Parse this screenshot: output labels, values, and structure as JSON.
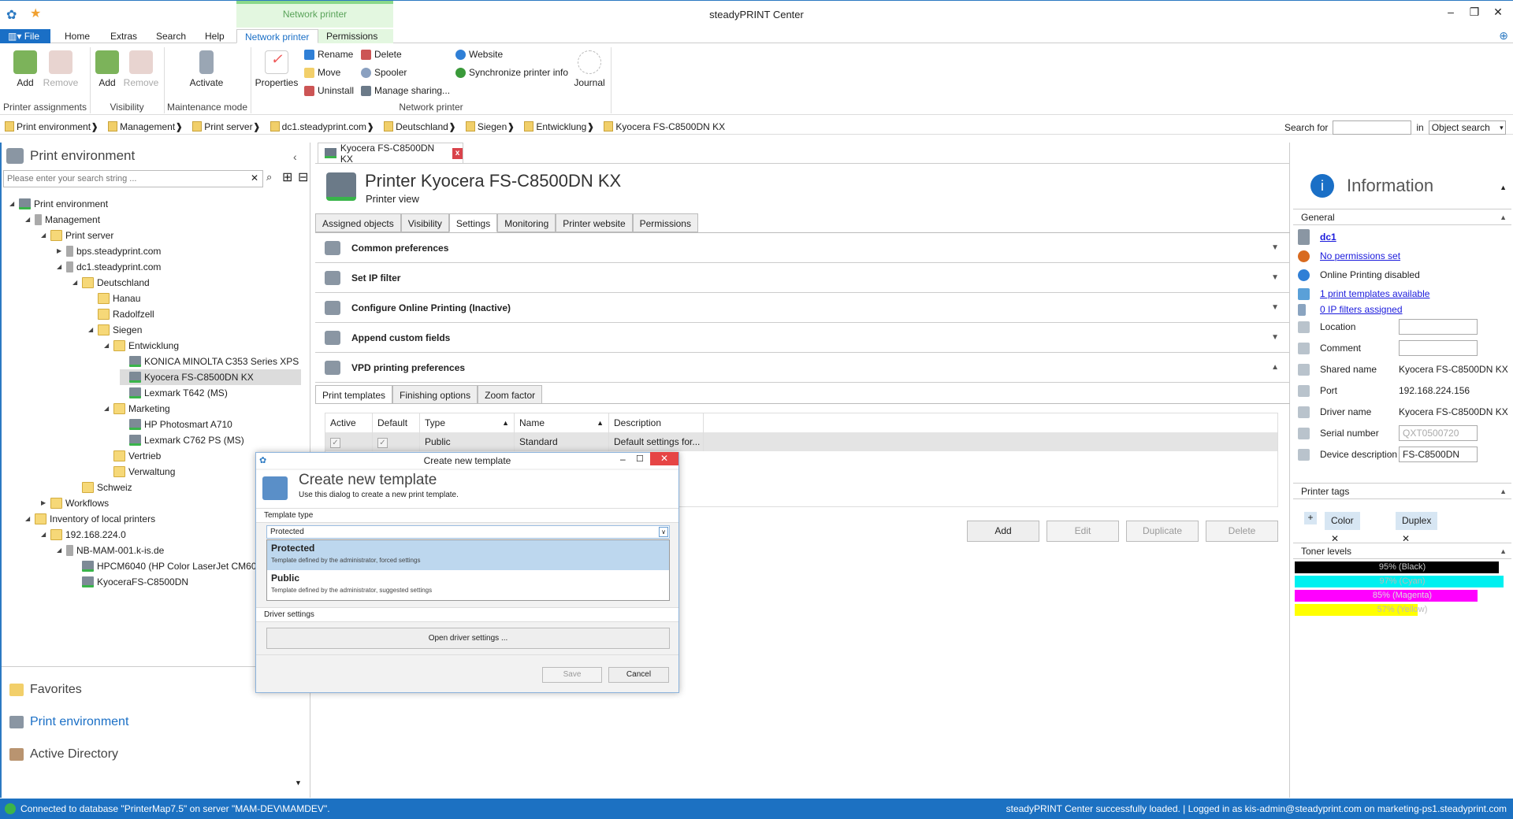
{
  "app": {
    "title": "steadyPRINT Center",
    "context_tab_group": "Network printer"
  },
  "menu_tabs": [
    "File",
    "Home",
    "Extras",
    "Search",
    "Help",
    "Network printer",
    "Permissions"
  ],
  "ribbon": {
    "printer_assignments": {
      "label": "Printer assignments",
      "add": "Add",
      "remove": "Remove"
    },
    "visibility": {
      "label": "Visibility",
      "add": "Add",
      "remove": "Remove"
    },
    "maintenance": {
      "label": "Maintenance mode",
      "activate": "Activate"
    },
    "network_printer": {
      "label": "Network printer",
      "properties": "Properties",
      "rename": "Rename",
      "move": "Move",
      "uninstall": "Uninstall",
      "delete": "Delete",
      "spooler": "Spooler",
      "manage_sharing": "Manage sharing...",
      "website": "Website",
      "sync": "Synchronize printer info",
      "journal": "Journal"
    }
  },
  "breadcrumb": [
    "Print environment",
    "Management",
    "Print server",
    "dc1.steadyprint.com",
    "Deutschland",
    "Siegen",
    "Entwicklung",
    "Kyocera FS-C8500DN KX"
  ],
  "search": {
    "label": "Search for",
    "value": "",
    "in_label": "in",
    "scope": "Object search"
  },
  "left": {
    "title": "Print environment",
    "search_placeholder": "Please enter your search string ...",
    "tree": [
      {
        "label": "Print environment",
        "level": 0,
        "arrow": "◢",
        "icon": "p"
      },
      {
        "label": "Management",
        "level": 1,
        "arrow": "◢",
        "icon": "s"
      },
      {
        "label": "Print server",
        "level": 2,
        "arrow": "◢",
        "icon": "f"
      },
      {
        "label": "bps.steadyprint.com",
        "level": 3,
        "arrow": "▶",
        "icon": "s"
      },
      {
        "label": "dc1.steadyprint.com",
        "level": 3,
        "arrow": "◢",
        "icon": "s"
      },
      {
        "label": "Deutschland",
        "level": 4,
        "arrow": "◢",
        "icon": "f"
      },
      {
        "label": "Hanau",
        "level": 5,
        "arrow": "",
        "icon": "f"
      },
      {
        "label": "Radolfzell",
        "level": 5,
        "arrow": "",
        "icon": "f"
      },
      {
        "label": "Siegen",
        "level": 5,
        "arrow": "◢",
        "icon": "f"
      },
      {
        "label": "Entwicklung",
        "level": 6,
        "arrow": "◢",
        "icon": "f"
      },
      {
        "label": "KONICA MINOLTA C353 Series XPS",
        "level": 7,
        "arrow": "",
        "icon": "p"
      },
      {
        "label": "Kyocera FS-C8500DN KX",
        "level": 7,
        "arrow": "",
        "icon": "p",
        "selected": true
      },
      {
        "label": "Lexmark T642 (MS)",
        "level": 7,
        "arrow": "",
        "icon": "p"
      },
      {
        "label": "Marketing",
        "level": 6,
        "arrow": "◢",
        "icon": "f"
      },
      {
        "label": "HP Photosmart A710",
        "level": 7,
        "arrow": "",
        "icon": "p"
      },
      {
        "label": "Lexmark C762 PS (MS)",
        "level": 7,
        "arrow": "",
        "icon": "p"
      },
      {
        "label": "Vertrieb",
        "level": 6,
        "arrow": "",
        "icon": "f"
      },
      {
        "label": "Verwaltung",
        "level": 6,
        "arrow": "",
        "icon": "f"
      },
      {
        "label": "Schweiz",
        "level": 4,
        "arrow": "",
        "icon": "f"
      },
      {
        "label": "Workflows",
        "level": 2,
        "arrow": "▶",
        "icon": "f"
      },
      {
        "label": "Inventory of local printers",
        "level": 1,
        "arrow": "◢",
        "icon": "f"
      },
      {
        "label": "192.168.224.0",
        "level": 2,
        "arrow": "◢",
        "icon": "f"
      },
      {
        "label": "NB-MAM-001.k-is.de",
        "level": 3,
        "arrow": "◢",
        "icon": "s"
      },
      {
        "label": "HPCM6040 (HP Color LaserJet CM6040",
        "level": 4,
        "arrow": "",
        "icon": "p"
      },
      {
        "label": "KyoceraFS-C8500DN",
        "level": 4,
        "arrow": "",
        "icon": "p"
      }
    ],
    "nav": [
      "Favorites",
      "Print environment",
      "Active Directory"
    ]
  },
  "main": {
    "doc_tab": "Kyocera FS-C8500DN KX",
    "title": "Printer Kyocera FS-C8500DN KX",
    "subtitle": "Printer view",
    "tabs": [
      "Assigned objects",
      "Visibility",
      "Settings",
      "Monitoring",
      "Printer website",
      "Permissions"
    ],
    "sections": [
      "Common preferences",
      "Set IP filter",
      "Configure Online Printing (Inactive)",
      "Append custom fields",
      "VPD printing preferences"
    ],
    "subtabs": [
      "Print templates",
      "Finishing options",
      "Zoom factor"
    ],
    "columns": [
      "Active",
      "Default",
      "Type",
      "Name",
      "Description"
    ],
    "rows": [
      {
        "active": true,
        "default": true,
        "type": "Public",
        "name": "Standard",
        "description": "Default settings for..."
      }
    ],
    "buttons": {
      "add": "Add",
      "edit": "Edit",
      "duplicate": "Duplicate",
      "delete": "Delete"
    }
  },
  "info": {
    "title": "Information",
    "general": "General",
    "server": "dc1",
    "permissions": "No permissions set",
    "online": "Online Printing disabled",
    "templates": "1 print templates available",
    "ipfilters": "0 IP filters assigned",
    "fields": [
      {
        "label": "Location",
        "value": "",
        "box": true
      },
      {
        "label": "Comment",
        "value": "",
        "box": true
      },
      {
        "label": "Shared name",
        "value": "Kyocera FS-C8500DN KX"
      },
      {
        "label": "Port",
        "value": "192.168.224.156"
      },
      {
        "label": "Driver name",
        "value": "Kyocera FS-C8500DN KX"
      },
      {
        "label": "Serial number",
        "value": "QXT0500720",
        "box": true,
        "disabled": true
      },
      {
        "label": "Device description",
        "value": "FS-C8500DN",
        "box": true
      }
    ],
    "tags_title": "Printer tags",
    "tags": [
      "Color",
      "Duplex"
    ],
    "toner_title": "Toner levels",
    "toner": [
      {
        "label": "95% (Black)",
        "percent": 95,
        "color": "#000000",
        "text": "#cccccc"
      },
      {
        "label": "97% (Cyan)",
        "percent": 97,
        "color": "#00f0f0",
        "text": "#bbbbbb"
      },
      {
        "label": "85% (Magenta)",
        "percent": 85,
        "color": "#ff00ff",
        "text": "#dddddd"
      },
      {
        "label": "57% (Yellow)",
        "percent": 57,
        "color": "#ffff00",
        "text": "#bbbbbb"
      }
    ]
  },
  "dialog": {
    "window_title": "Create new template",
    "title": "Create new template",
    "subtitle": "Use this dialog to create a new print template.",
    "template_type": "Template type",
    "selected": "Protected",
    "options": [
      {
        "name": "Protected",
        "desc": "Template defined by the administrator, forced settings"
      },
      {
        "name": "Public",
        "desc": "Template defined by the administrator, suggested settings"
      }
    ],
    "driver_settings": "Driver settings",
    "open_driver": "Open driver settings ...",
    "save": "Save",
    "cancel": "Cancel"
  },
  "status": {
    "left": "Connected to database \"PrinterMap7.5\" on server \"MAM-DEV\\MAMDEV\".",
    "right": "steadyPRINT Center successfully loaded. | Logged in as kis-admin@steadyprint.com on marketing-ps1.steadyprint.com"
  },
  "colors": {
    "accent": "#1a6fc6",
    "status_bar": "#1c71c2",
    "context_tab": "#e3f7e0"
  }
}
